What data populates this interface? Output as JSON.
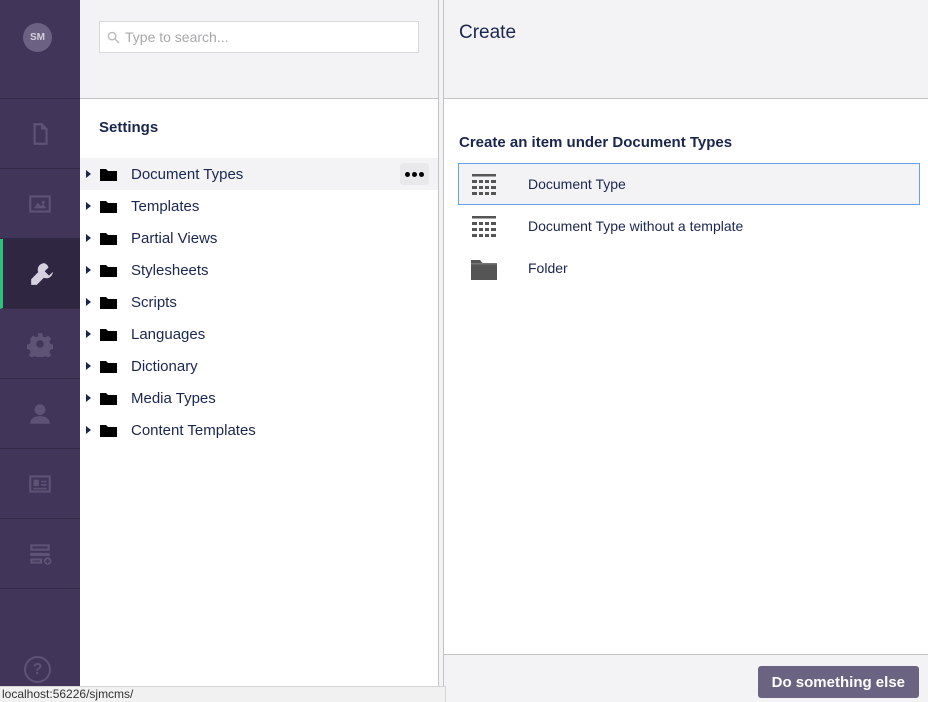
{
  "user": {
    "initials": "SM"
  },
  "rail": {
    "items": [
      {
        "name": "content",
        "icon": "document-icon"
      },
      {
        "name": "media",
        "icon": "image-icon"
      },
      {
        "name": "settings",
        "icon": "wrench-icon",
        "active": true
      },
      {
        "name": "packages",
        "icon": "gear-icon"
      },
      {
        "name": "users",
        "icon": "user-icon"
      },
      {
        "name": "members",
        "icon": "id-card-icon"
      },
      {
        "name": "forms",
        "icon": "forms-icon"
      }
    ],
    "help_glyph": "?"
  },
  "search": {
    "placeholder": "Type to search..."
  },
  "tree": {
    "title": "Settings",
    "items": [
      {
        "label": "Document Types"
      },
      {
        "label": "Templates"
      },
      {
        "label": "Partial Views"
      },
      {
        "label": "Stylesheets"
      },
      {
        "label": "Scripts"
      },
      {
        "label": "Languages"
      },
      {
        "label": "Dictionary"
      },
      {
        "label": "Media Types"
      },
      {
        "label": "Content Templates"
      }
    ]
  },
  "create": {
    "title": "Create",
    "heading": "Create an item under Document Types",
    "options": [
      {
        "label": "Document Type",
        "icon": "grid-icon",
        "selected": true
      },
      {
        "label": "Document Type without a template",
        "icon": "grid-icon"
      },
      {
        "label": "Folder",
        "icon": "folder-icon"
      }
    ],
    "secondary_button": "Do something else"
  },
  "status_bar": {
    "url": "localhost:56226/sjmcms/"
  },
  "colors": {
    "rail": "#413659",
    "accent": "#2bc37c",
    "button": "#6b6382",
    "selected_border": "#6b9ee8"
  }
}
